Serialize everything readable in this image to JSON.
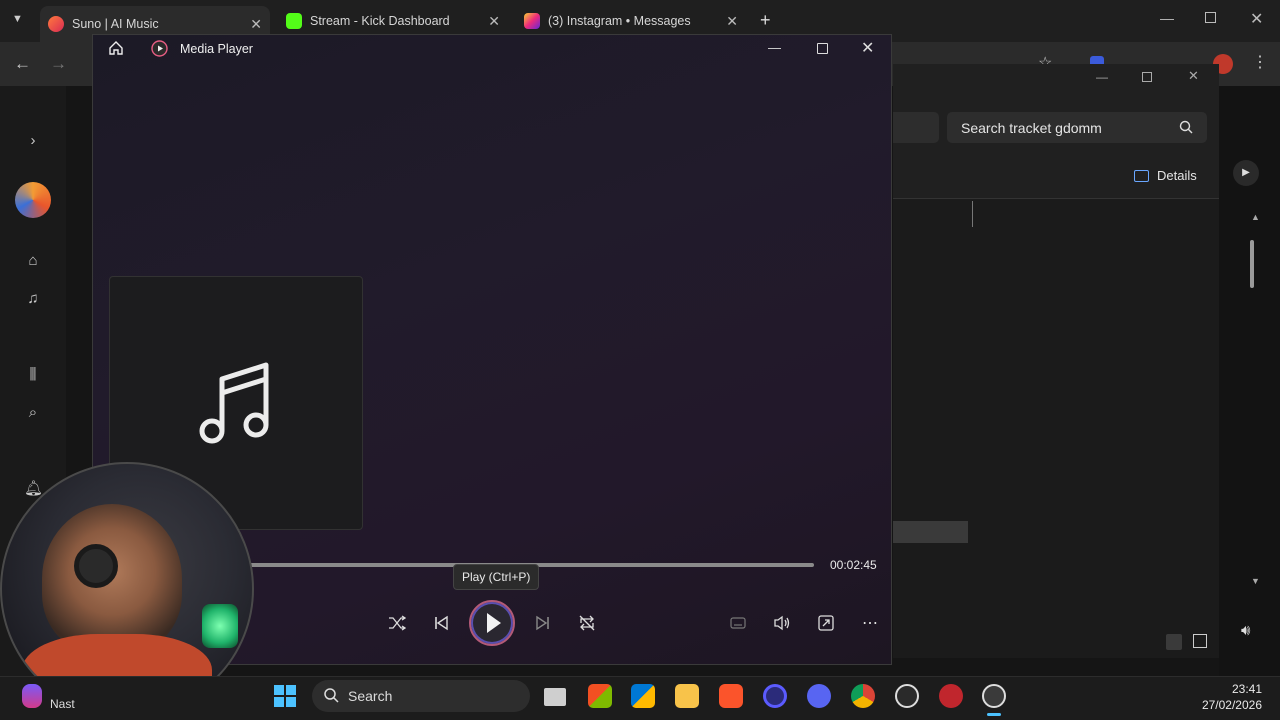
{
  "browser": {
    "tabs": [
      {
        "title": "Suno | AI Music",
        "active": true
      },
      {
        "title": "Stream - Kick Dashboard",
        "active": false
      },
      {
        "title": "(3) Instagram • Messages",
        "active": false
      }
    ],
    "new_tab": "+"
  },
  "background_window": {
    "search_placeholder": "Search tracket gdomm",
    "details_label": "Details"
  },
  "media_player": {
    "title": "Media Player",
    "total_time": "00:02:45",
    "play_tooltip": "Play (Ctrl+P)",
    "progress": 0.0,
    "colors": {
      "accent_ring": "#b35a78",
      "inner_ring": "#5a4fb0"
    }
  },
  "taskbar": {
    "search_label": "Search",
    "time": "23:41",
    "date": "27/02/2026",
    "user_label": "Nast"
  }
}
